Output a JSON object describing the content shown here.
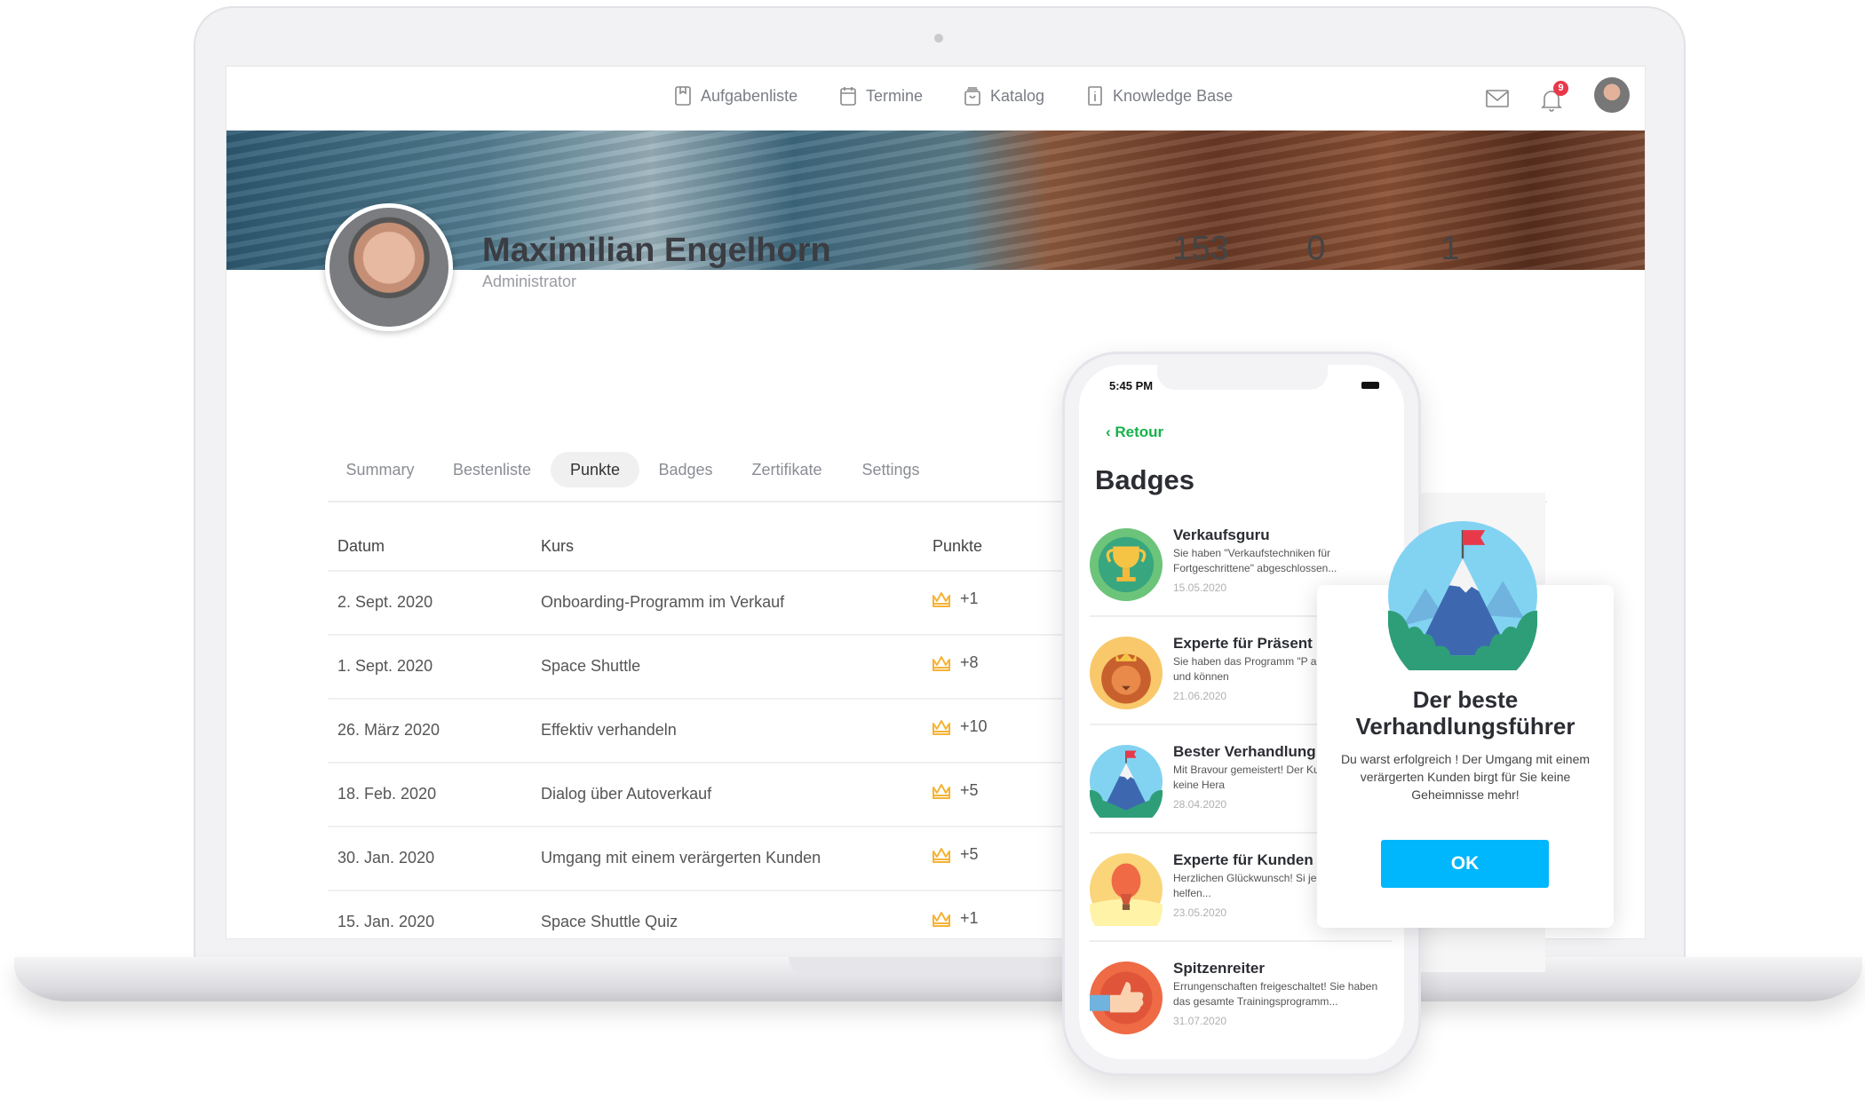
{
  "nav": {
    "items": [
      {
        "label": "Aufgabenliste",
        "icon": "bookmark-book-icon"
      },
      {
        "label": "Termine",
        "icon": "calendar-icon"
      },
      {
        "label": "Katalog",
        "icon": "shopping-bag-icon"
      },
      {
        "label": "Knowledge Base",
        "icon": "info-icon"
      }
    ],
    "notifications_count": "9"
  },
  "profile": {
    "name": "Maximilian Engelhorn",
    "role": "Administrator",
    "stats": [
      "153",
      "0",
      "1"
    ]
  },
  "tabs": [
    {
      "label": "Summary"
    },
    {
      "label": "Bestenliste"
    },
    {
      "label": "Punkte",
      "active": true
    },
    {
      "label": "Badges"
    },
    {
      "label": "Zertifikate"
    },
    {
      "label": "Settings"
    }
  ],
  "table": {
    "headers": [
      "Datum",
      "Kurs",
      "Punkte"
    ],
    "rows": [
      {
        "date": "2. Sept. 2020",
        "course": "Onboarding-Programm im Verkauf",
        "points": "+1"
      },
      {
        "date": "1. Sept. 2020",
        "course": "Space Shuttle",
        "points": "+8"
      },
      {
        "date": "26. März 2020",
        "course": "Effektiv verhandeln",
        "points": "+10"
      },
      {
        "date": "18. Feb. 2020",
        "course": "Dialog über Autoverkauf",
        "points": "+5"
      },
      {
        "date": "30. Jan. 2020",
        "course": "Umgang mit einem verärgerten Kunden",
        "points": "+5"
      },
      {
        "date": "15. Jan. 2020",
        "course": "Space Shuttle Quiz",
        "points": "+1"
      }
    ]
  },
  "phone": {
    "time": "5:45 PM",
    "back_label": "Retour",
    "title": "Badges",
    "badges": [
      {
        "title": "Verkaufsguru",
        "desc": "Sie haben \"Verkaufstechniken für Fortgeschrittene\" abgeschlossen...",
        "date": "15.05.2020",
        "icon": "trophy-icon"
      },
      {
        "title": "Experte für Präsent",
        "desc": "Sie haben das Programm \"P abgeschlossen und können",
        "date": "21.06.2020",
        "icon": "lion-icon"
      },
      {
        "title": "Bester Verhandlung",
        "desc": "Mit Bravour gemeistert! Der Kunden ist für Sie keine Hera",
        "date": "28.04.2020",
        "icon": "mountain-flag-icon"
      },
      {
        "title": "Experte für Kunden",
        "desc": "Herzlichen Glückwunsch! Si jedem Kunden helfen...",
        "date": "23.05.2020",
        "icon": "hot-air-balloon-icon"
      },
      {
        "title": "Spitzenreiter",
        "desc": "Errungenschaften freigeschaltet! Sie haben das gesamte Trainingsprogramm...",
        "date": "31.07.2020",
        "icon": "thumbs-up-icon"
      }
    ]
  },
  "modal": {
    "title_line1": "Der beste",
    "title_line2": "Verhandlungsführer",
    "body": "Du warst erfolgreich ! Der Umgang mit einem verärgerten Kunden birgt für Sie keine Geheimnisse mehr!",
    "ok_label": "OK"
  },
  "colors": {
    "accent_green": "#16b34a",
    "ok_blue": "#00b6fc",
    "crown": "#f5b335",
    "badge_red": "#e8394a"
  }
}
